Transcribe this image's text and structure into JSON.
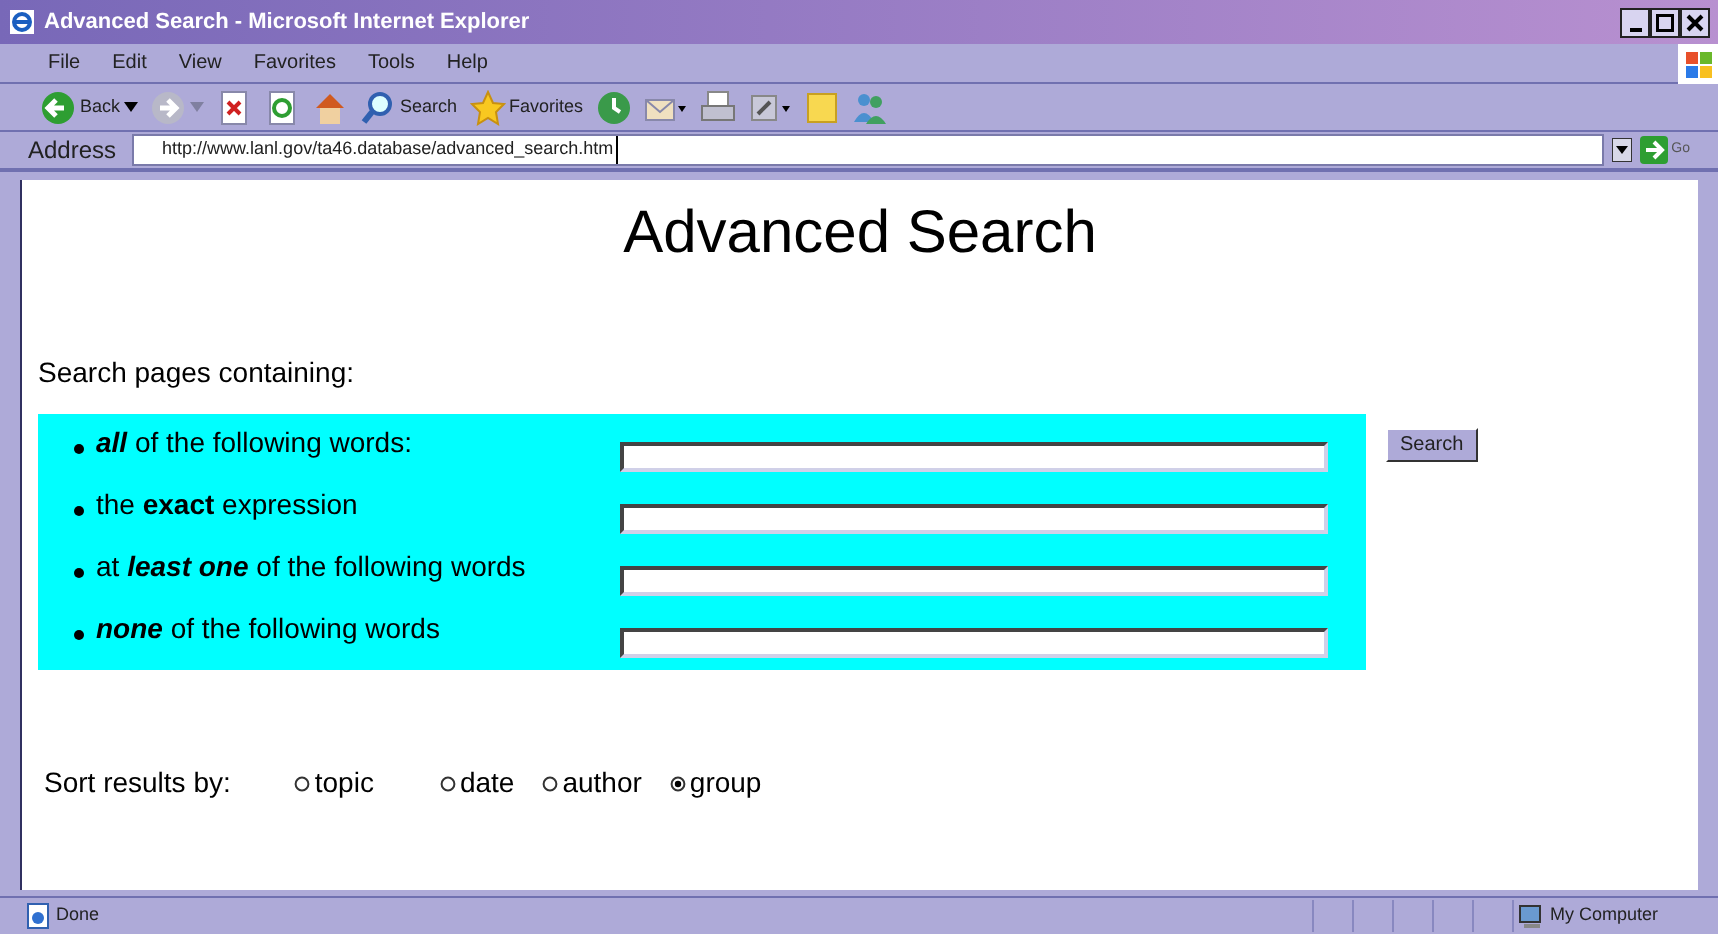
{
  "window": {
    "title": "Advanced Search - Microsoft Internet Explorer"
  },
  "menu": [
    "File",
    "Edit",
    "View",
    "Favorites",
    "Tools",
    "Help"
  ],
  "toolbar": [
    {
      "kind": "back",
      "label": "Back"
    },
    {
      "kind": "forward"
    },
    {
      "kind": "stop"
    },
    {
      "kind": "refresh"
    },
    {
      "kind": "home"
    },
    {
      "kind": "search",
      "label": "Search"
    },
    {
      "kind": "favorites",
      "label": "Favorites"
    },
    {
      "kind": "history"
    },
    {
      "kind": "mail"
    },
    {
      "kind": "print"
    },
    {
      "kind": "edit"
    },
    {
      "kind": "notes"
    },
    {
      "kind": "messenger"
    }
  ],
  "address": {
    "label": "Address",
    "value": "http://www.lanl.gov/ta46.database/advanced_search.htm",
    "go": "Go"
  },
  "page": {
    "heading": "Advanced Search",
    "intro": "Search pages containing:",
    "criteria": [
      {
        "text": "**all** of the following words:",
        "italic_emphasis": true
      },
      {
        "text": "the **exact** expression",
        "italic_emphasis": false
      },
      {
        "text": "at **least one** of the following words",
        "italic_emphasis": true
      },
      {
        "text": "**none** of the following words",
        "italic_emphasis": true
      }
    ],
    "search_button": "Search",
    "sort_label": "Sort results by:",
    "sort_options": [
      {
        "label": "topic",
        "selected": false
      },
      {
        "label": "date",
        "selected": false
      },
      {
        "label": "author",
        "selected": false
      },
      {
        "label": "group",
        "selected": true
      }
    ]
  },
  "status_bar": {
    "text": "Done",
    "zone": "My Computer"
  }
}
